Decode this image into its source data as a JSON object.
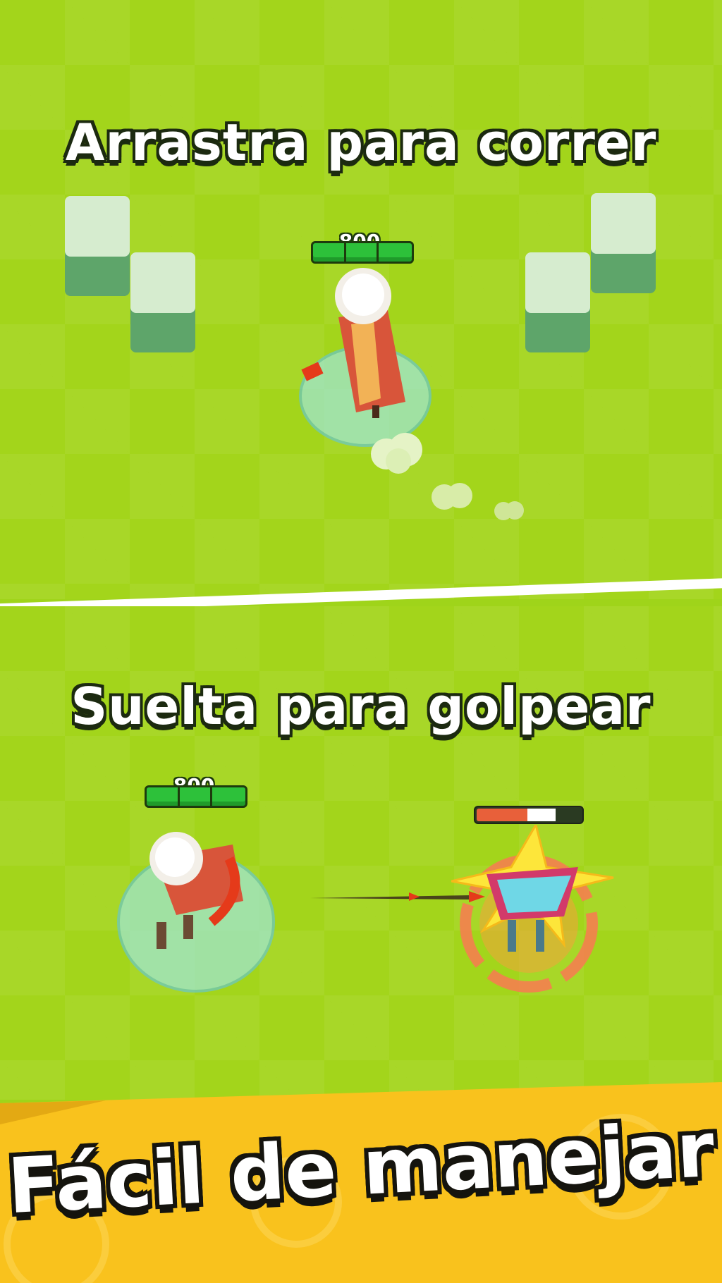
{
  "top_panel": {
    "caption": "Arrastra para correr",
    "player_hp": "800"
  },
  "bottom_panel": {
    "caption": "Suelta para golpear",
    "player_hp": "800",
    "enemy_health_fraction": 0.5
  },
  "banner": {
    "title": "Fácil de manejar"
  },
  "colors": {
    "grass": "#a3d51b",
    "banner": "#f9c21d",
    "hp_green": "#2dc13a",
    "enemy_hp": "#e8603a"
  }
}
